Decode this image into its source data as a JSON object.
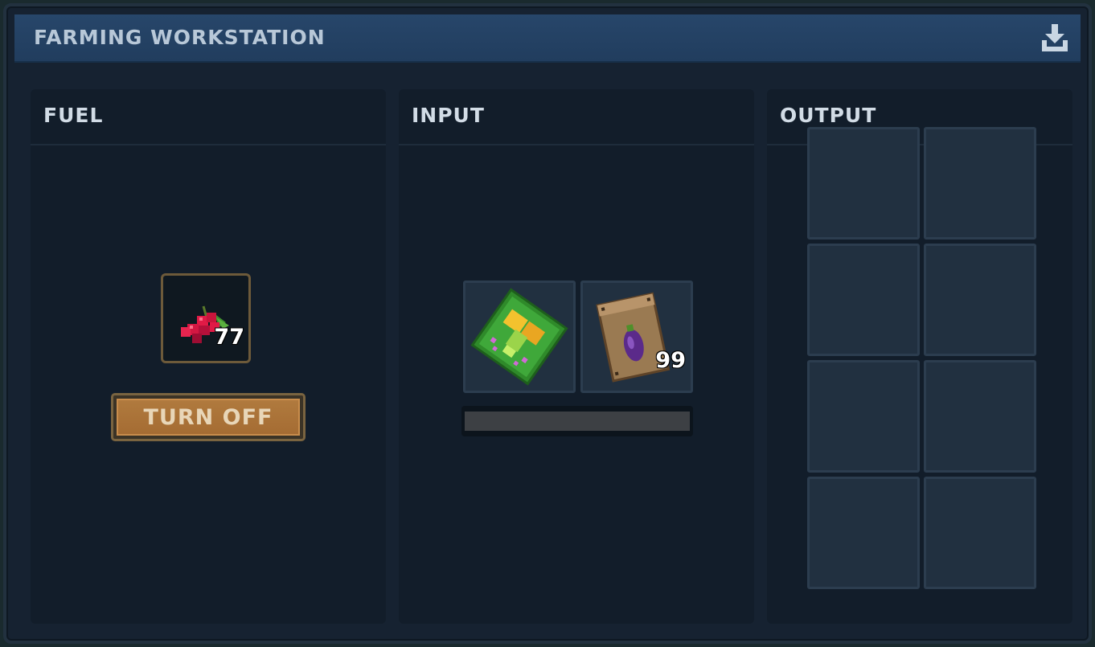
{
  "window": {
    "title": "FARMING WORKSTATION",
    "collect_icon": "download-tray-icon"
  },
  "fuel": {
    "title": "FUEL",
    "slot": {
      "item_icon": "red-berries-icon",
      "count": "77"
    },
    "toggle_label": "TURN OFF"
  },
  "input": {
    "title": "INPUT",
    "slots": [
      {
        "item_icon": "fertilizer-planter-icon",
        "count": ""
      },
      {
        "item_icon": "eggplant-seed-packet-icon",
        "count": "99"
      }
    ],
    "progress": 0
  },
  "output": {
    "title": "OUTPUT",
    "slot_count": 8,
    "slots": [
      {
        "item_icon": "",
        "count": ""
      },
      {
        "item_icon": "",
        "count": ""
      },
      {
        "item_icon": "",
        "count": ""
      },
      {
        "item_icon": "",
        "count": ""
      },
      {
        "item_icon": "",
        "count": ""
      },
      {
        "item_icon": "",
        "count": ""
      },
      {
        "item_icon": "",
        "count": ""
      },
      {
        "item_icon": "",
        "count": ""
      }
    ]
  },
  "colors": {
    "accent_title_bar": "#27466a",
    "button_orange": "#b07a3e",
    "panel_bg": "#121d2a",
    "slot_bg": "#213040"
  }
}
